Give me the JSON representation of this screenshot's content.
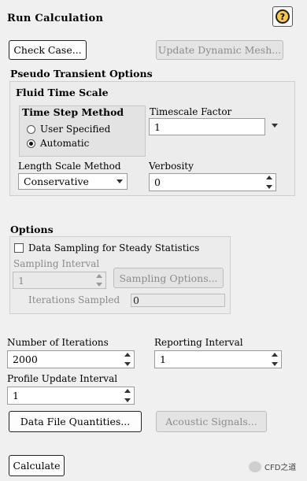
{
  "header": {
    "title": "Run Calculation",
    "help_icon": "help-icon",
    "help_glyph": "?"
  },
  "actions": {
    "check_case": "Check Case...",
    "update_mesh": "Update Dynamic Mesh..."
  },
  "pseudo": {
    "title": "Pseudo Transient Options",
    "fluid_title": "Fluid Time Scale",
    "time_step_method": {
      "label": "Time Step Method",
      "options": [
        "User Specified",
        "Automatic"
      ],
      "selected": "Automatic"
    },
    "timescale_factor": {
      "label": "Timescale Factor",
      "value": "1"
    },
    "length_scale": {
      "label": "Length Scale Method",
      "value": "Conservative"
    },
    "verbosity": {
      "label": "Verbosity",
      "value": "0"
    }
  },
  "options": {
    "title": "Options",
    "data_sampling": {
      "label": "Data Sampling for Steady Statistics",
      "checked": false
    },
    "sampling_interval": {
      "label": "Sampling Interval",
      "value": "1"
    },
    "sampling_options": "Sampling Options...",
    "iterations_sampled": {
      "label": "Iterations Sampled",
      "value": "0"
    }
  },
  "run": {
    "num_iterations": {
      "label": "Number of Iterations",
      "value": "2000"
    },
    "reporting_interval": {
      "label": "Reporting Interval",
      "value": "1"
    },
    "profile_update": {
      "label": "Profile Update Interval",
      "value": "1"
    },
    "data_file_quantities": "Data File Quantities...",
    "acoustic_signals": "Acoustic Signals...",
    "calculate": "Calculate"
  },
  "watermark": {
    "text": "CFD之道"
  }
}
